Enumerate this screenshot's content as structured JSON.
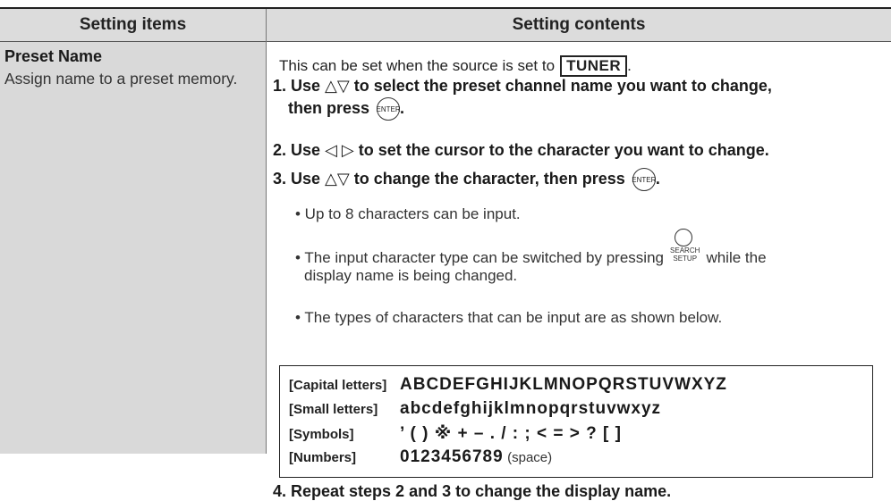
{
  "header": {
    "items_heading": "Setting items",
    "contents_heading": "Setting contents"
  },
  "item": {
    "title": "Preset Name",
    "description": "Assign name to a preset memory."
  },
  "contents": {
    "intro_text": "This can be set when the source is set to",
    "intro_key": "TUNER",
    "intro_end": ".",
    "enter_icon_label": "ENTER",
    "step1_line1": "1. Use △▽ to select the preset channel name you want to change,",
    "step1_line2": "then press",
    "step2": "2. Use ◁ ▷ to set the cursor to the character you want to change.",
    "step3": "3. Use △▽ to change the character, then press",
    "bullet1": "• Up to 8 characters can be input.",
    "bullet2_pre": "• The input character type can be switched by pressing",
    "bullet2_post": "while the",
    "bullet2_line2": "display name is being changed.",
    "search_label_top": "SEARCH",
    "search_label_bottom": "SETUP",
    "bullet3": "• The types of characters that can be input are as shown below.",
    "step4": "4. Repeat steps 2 and 3 to change the display name."
  },
  "character_table": [
    {
      "label": "[Capital letters]",
      "values": "ABCDEFGHIJKLMNOPQRSTUVWXYZ",
      "note": ""
    },
    {
      "label": "[Small letters]",
      "values": "abcdefghijklmnopqrstuvwxyz",
      "note": ""
    },
    {
      "label": "[Symbols]",
      "values": "’ ( ) ※ + – . / : ; < = > ? [ ]",
      "note": ""
    },
    {
      "label": "[Numbers]",
      "values": "0123456789",
      "note": "(space)"
    }
  ]
}
